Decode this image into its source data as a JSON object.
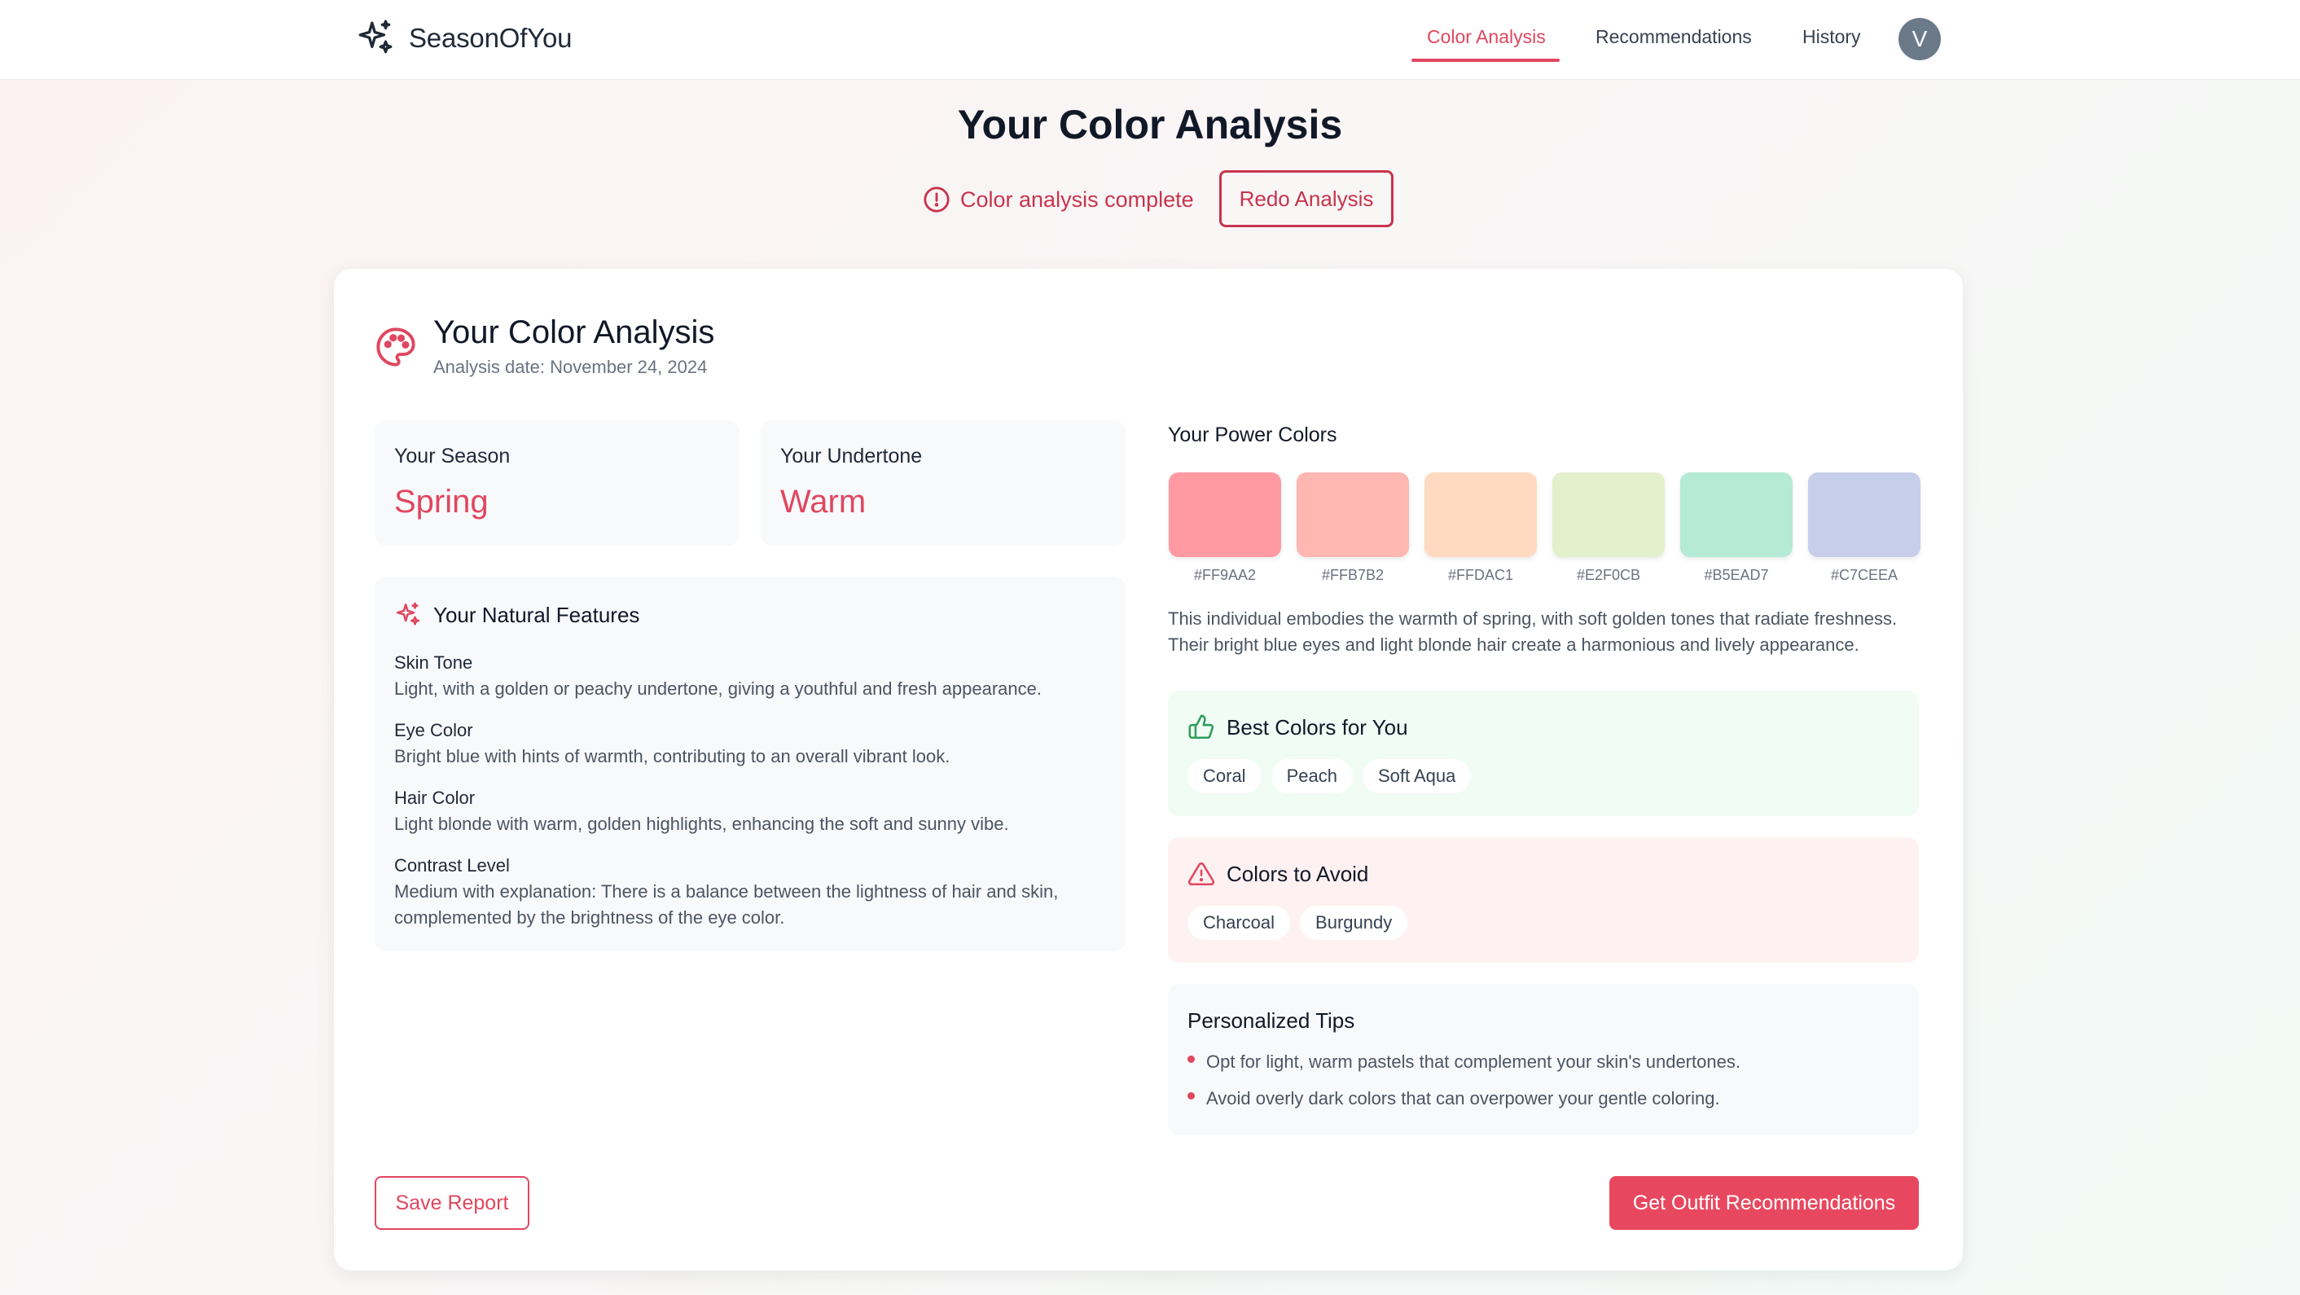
{
  "nav": {
    "brand": "SeasonOfYou",
    "brand_icon": "sparkles-icon",
    "links": [
      {
        "label": "Color Analysis",
        "active": true
      },
      {
        "label": "Recommendations",
        "active": false
      },
      {
        "label": "History",
        "active": false
      }
    ],
    "avatar_initial": "V"
  },
  "header": {
    "title": "Your Color Analysis",
    "status": "Color analysis complete",
    "status_icon": "alert-circle-icon",
    "redo_label": "Redo Analysis"
  },
  "card": {
    "icon": "palette-icon",
    "title": "Your Color Analysis",
    "date": "Analysis date: November 24, 2024",
    "season": {
      "label": "Your Season",
      "value": "Spring"
    },
    "undertone": {
      "label": "Your Undertone",
      "value": "Warm"
    },
    "features": {
      "title": "Your Natural Features",
      "icon": "sparkles-icon",
      "items": [
        {
          "name": "Skin Tone",
          "desc": "Light, with a golden or peachy undertone, giving a youthful and fresh appearance."
        },
        {
          "name": "Eye Color",
          "desc": "Bright blue with hints of warmth, contributing to an overall vibrant look."
        },
        {
          "name": "Hair Color",
          "desc": "Light blonde with warm, golden highlights, enhancing the soft and sunny vibe."
        },
        {
          "name": "Contrast Level",
          "desc": "Medium with explanation: There is a balance between the lightness of hair and skin, complemented by the brightness of the eye color."
        }
      ]
    },
    "power_colors": {
      "title": "Your Power Colors",
      "swatches": [
        "#FF9AA2",
        "#FFB7B2",
        "#FFDAC1",
        "#E2F0CB",
        "#B5EAD7",
        "#C7CEEA"
      ]
    },
    "description": "This individual embodies the warmth of spring, with soft golden tones that radiate freshness. Their bright blue eyes and light blonde hair create a harmonious and lively appearance.",
    "best": {
      "title": "Best Colors for You",
      "icon": "thumbs-up-icon",
      "chips": [
        "Coral",
        "Peach",
        "Soft Aqua"
      ]
    },
    "avoid": {
      "title": "Colors to Avoid",
      "icon": "warning-triangle-icon",
      "chips": [
        "Charcoal",
        "Burgundy"
      ]
    },
    "tips": {
      "title": "Personalized Tips",
      "items": [
        "Opt for light, warm pastels that complement your skin's undertones.",
        "Avoid overly dark colors that can overpower your gentle coloring."
      ]
    },
    "save_label": "Save Report",
    "outfit_label": "Get Outfit Recommendations"
  },
  "colors": {
    "accent": "#E0475F",
    "accent_dark": "#C8344D",
    "best_bg": "#F0FCF4",
    "avoid_bg": "#FEF1F1",
    "tile_bg": "#F8F9FB"
  }
}
